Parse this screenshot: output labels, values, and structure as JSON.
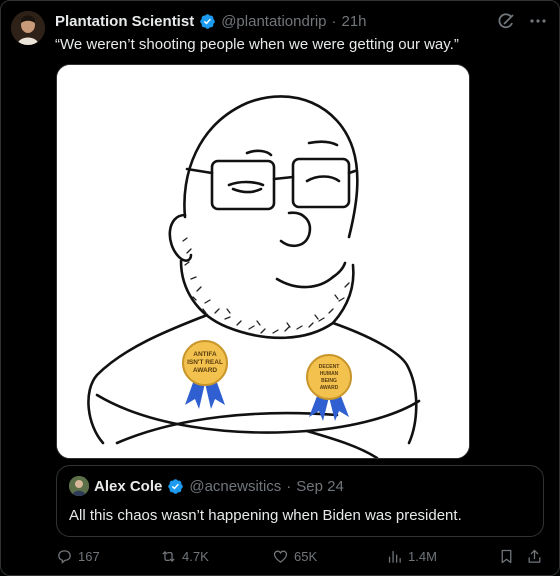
{
  "post": {
    "author": {
      "display_name": "Plantation Scientist",
      "handle": "@plantationdrip",
      "separator": "·",
      "time": "21h",
      "verified": true
    },
    "text": "“We weren’t shooting people when we were getting our way.”",
    "media": {
      "badges": [
        {
          "text": "ANTIFA ISN'T REAL AWARD",
          "lines": [
            "ANTIFA",
            "ISN'T REAL",
            "AWARD"
          ]
        },
        {
          "text": "DECENT HUMAN BEING AWARD",
          "lines": [
            "DECENT",
            "HUMAN",
            "BEING",
            "AWARD"
          ]
        }
      ]
    },
    "quote": {
      "display_name": "Alex Cole",
      "handle": "@acnewsitics",
      "separator": "·",
      "date": "Sep 24",
      "verified": true,
      "text": "All this chaos wasn’t happening when Biden was president."
    },
    "actions": {
      "replies": "167",
      "reposts": "4.7K",
      "likes": "65K",
      "views": "1.4M"
    }
  },
  "colors": {
    "background": "#000000",
    "text": "#e7e9ea",
    "muted": "#71767b",
    "border": "#2f3336",
    "verified_blue": "#1d9bf0",
    "badge_gold": "#f2c14e",
    "ribbon_blue": "#2f5fd0"
  },
  "icons": [
    "verified-badge-icon",
    "grok-icon",
    "more-icon",
    "reply-icon",
    "repost-icon",
    "like-icon",
    "views-icon",
    "bookmark-icon",
    "share-icon"
  ]
}
